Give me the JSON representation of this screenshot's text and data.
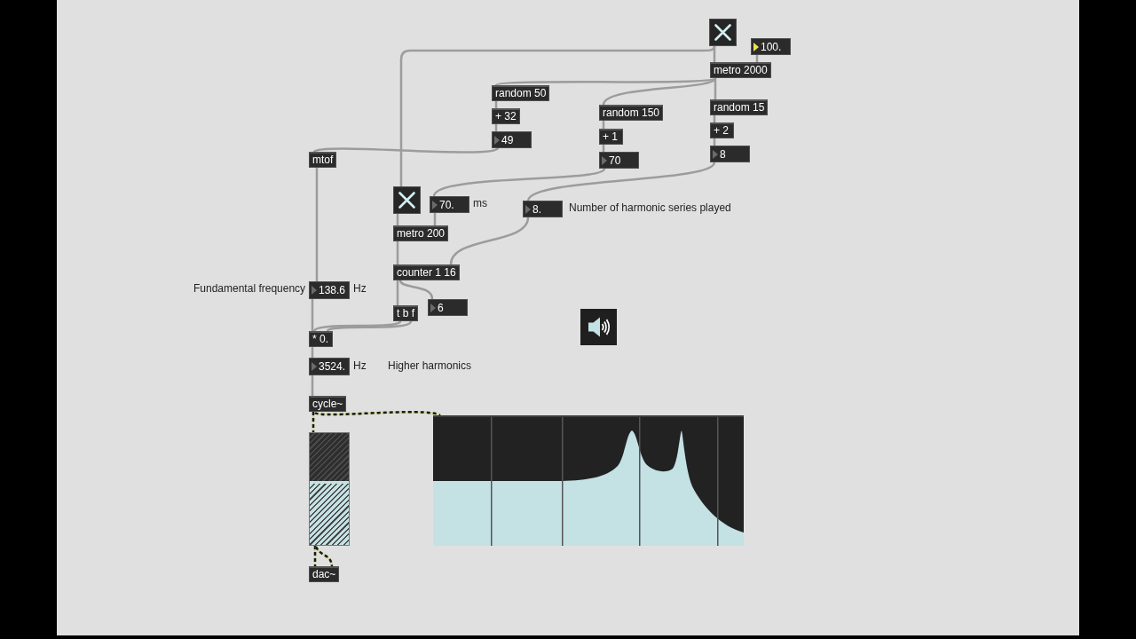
{
  "patch": {
    "items": [
      {
        "kind": "toggle",
        "checked": true
      },
      {
        "kind": "number",
        "value": "100.",
        "highlighted": true
      },
      {
        "kind": "object",
        "text": "metro 2000"
      },
      {
        "kind": "object",
        "text": "random 50"
      },
      {
        "kind": "object",
        "text": "random 15"
      },
      {
        "kind": "object",
        "text": "random 150"
      },
      {
        "kind": "object",
        "text": "+ 32"
      },
      {
        "kind": "object",
        "text": "+ 2"
      },
      {
        "kind": "object",
        "text": "+ 1"
      },
      {
        "kind": "number",
        "value": "49",
        "highlighted": false
      },
      {
        "kind": "number",
        "value": "8",
        "highlighted": false
      },
      {
        "kind": "object",
        "text": "mtof"
      },
      {
        "kind": "number",
        "value": "70",
        "highlighted": false
      },
      {
        "kind": "toggle",
        "checked": true
      },
      {
        "kind": "number",
        "value": "70.",
        "highlighted": false
      },
      {
        "kind": "comment",
        "text": "ms"
      },
      {
        "kind": "number",
        "value": "8.",
        "highlighted": false
      },
      {
        "kind": "comment",
        "text": "Number of harmonic series played"
      },
      {
        "kind": "object",
        "text": "metro 200"
      },
      {
        "kind": "object",
        "text": "counter 1 16"
      },
      {
        "kind": "comment",
        "text": "Fundamental frequency"
      },
      {
        "kind": "number",
        "value": "138.6",
        "highlighted": false
      },
      {
        "kind": "comment",
        "text": "Hz"
      },
      {
        "kind": "number",
        "value": "6",
        "highlighted": false
      },
      {
        "kind": "object",
        "text": "t b f"
      },
      {
        "kind": "speaker",
        "on": true
      },
      {
        "kind": "object",
        "text": "* 0."
      },
      {
        "kind": "number",
        "value": "3524.",
        "highlighted": false
      },
      {
        "kind": "comment",
        "text": "Hz"
      },
      {
        "kind": "comment",
        "text": "Higher harmonics"
      },
      {
        "kind": "object",
        "text": "cycle~"
      },
      {
        "kind": "spectroscope"
      },
      {
        "kind": "gain",
        "level": 0.57
      },
      {
        "kind": "object",
        "text": "dac~"
      }
    ]
  }
}
